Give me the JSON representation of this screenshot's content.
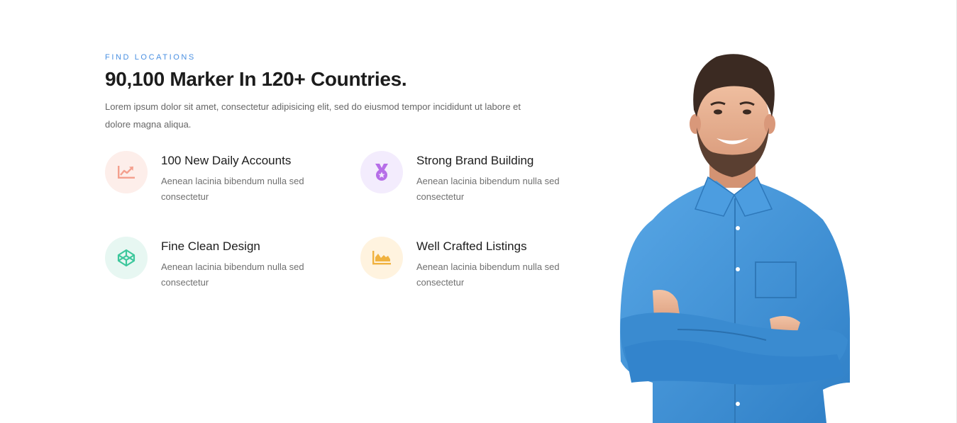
{
  "section": {
    "eyebrow": "FIND LOCATIONS",
    "heading": "90,100 Marker In 120+ Countries.",
    "lead": "Lorem ipsum dolor sit amet, consectetur adipisicing elit, sed do eiusmod tempor incididunt ut labore et dolore magna aliqua."
  },
  "features": [
    {
      "title": "100 New Daily Accounts",
      "desc": "Aenean lacinia bibendum nulla sed consectetur",
      "icon": "chart-line-icon",
      "color": "#f4a08e"
    },
    {
      "title": "Strong Brand Building",
      "desc": "Aenean lacinia bibendum nulla sed consectetur",
      "icon": "medal-icon",
      "color": "#b66ee8"
    },
    {
      "title": "Fine Clean Design",
      "desc": "Aenean lacinia bibendum nulla sed consectetur",
      "icon": "codepen-icon",
      "color": "#3cc79c"
    },
    {
      "title": "Well Crafted Listings",
      "desc": "Aenean lacinia bibendum nulla sed consectetur",
      "icon": "area-chart-icon",
      "color": "#f0b240"
    }
  ],
  "colors": {
    "accent": "#4a90e2",
    "shirt": "#3f93d8"
  }
}
